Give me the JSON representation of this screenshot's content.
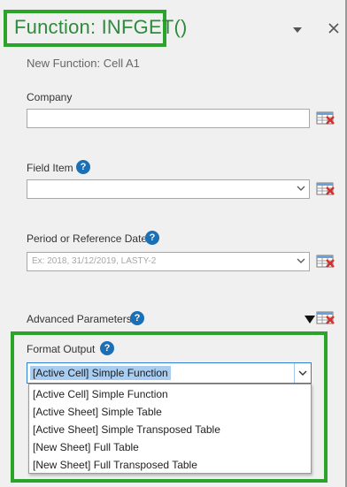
{
  "header": {
    "title": "Function: INFGET()",
    "subtitle": "New Function: Cell A1"
  },
  "company": {
    "label": "Company",
    "value": "",
    "placeholder": ""
  },
  "field_item": {
    "label": "Field Item",
    "value": ""
  },
  "period": {
    "label": "Period or Reference Date",
    "placeholder": "Ex: 2018, 31/12/2019, LASTY-2"
  },
  "advanced": {
    "label": "Advanced Parameters"
  },
  "format_output": {
    "label": "Format Output",
    "selected": "[Active Cell] Simple Function",
    "options": [
      "[Active Cell] Simple Function",
      "[Active Sheet] Simple Table",
      "[Active Sheet] Simple Transposed Table",
      "[New Sheet] Full Table",
      "[New Sheet] Full Transposed Table"
    ]
  },
  "icons": {
    "help": "question-mark",
    "table_picker": "table-picker-icon",
    "dropdown": "chevron-down-icon",
    "close": "close-icon"
  },
  "colors": {
    "highlight_box": "#2aa52a",
    "title_text": "#2e8b3c",
    "help_icon": "#1a6fb5",
    "selected_bg": "#a9cdf1"
  }
}
